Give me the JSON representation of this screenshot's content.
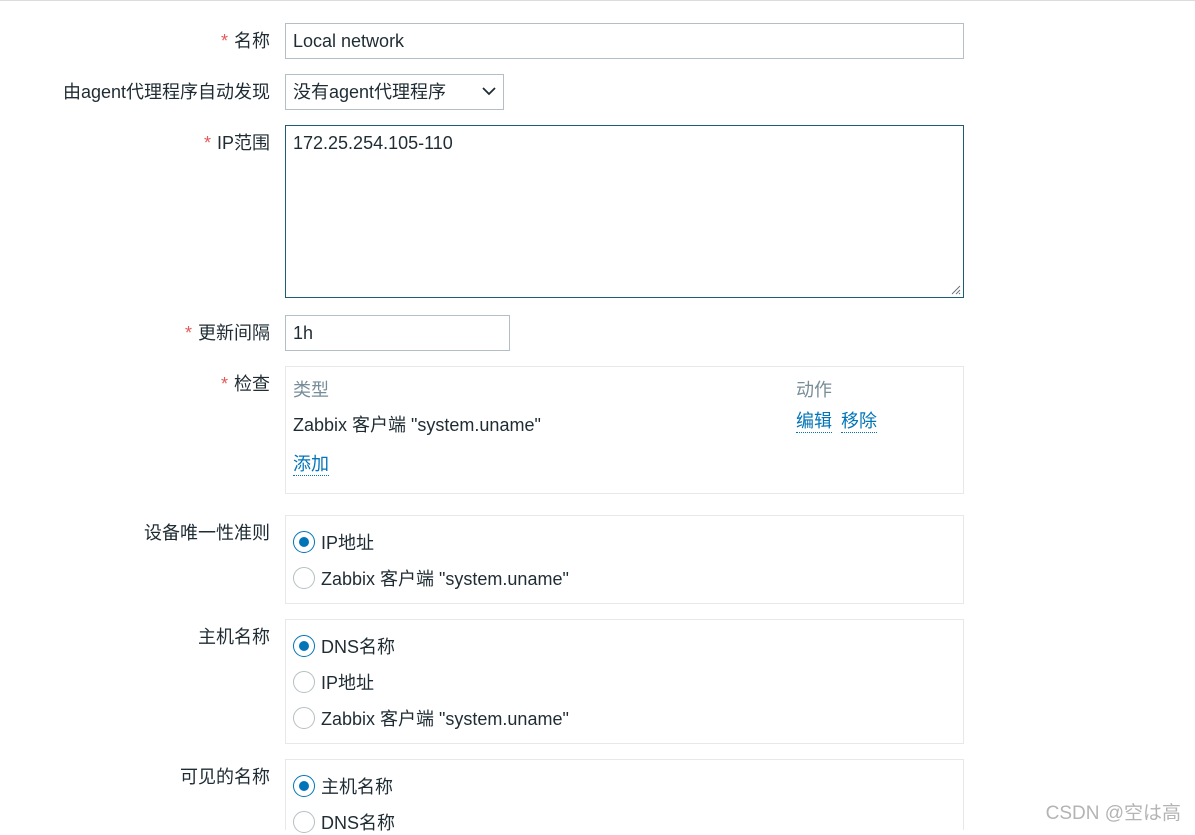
{
  "form": {
    "name": {
      "label": "名称",
      "value": "Local network"
    },
    "discovery_by_proxy": {
      "label": "由agent代理程序自动发现",
      "selected": "没有agent代理程序"
    },
    "ip_range": {
      "label": "IP范围",
      "value": "172.25.254.105-110"
    },
    "update_interval": {
      "label": "更新间隔",
      "value": "1h"
    },
    "checks": {
      "label": "检查",
      "columns": {
        "type": "类型",
        "action": "动作"
      },
      "rows": [
        {
          "type": "Zabbix 客户端 \"system.uname\"",
          "edit": "编辑",
          "remove": "移除"
        }
      ],
      "add_label": "添加"
    },
    "uniqueness": {
      "label": "设备唯一性准则",
      "options": [
        "IP地址",
        "Zabbix 客户端 \"system.uname\""
      ],
      "selected_index": 0
    },
    "host_name": {
      "label": "主机名称",
      "options": [
        "DNS名称",
        "IP地址",
        "Zabbix 客户端 \"system.uname\""
      ],
      "selected_index": 0
    },
    "visible_name": {
      "label": "可见的名称",
      "options": [
        "主机名称",
        "DNS名称"
      ],
      "selected_index": 0
    },
    "required_marker": "*"
  },
  "watermark": "CSDN @空は高",
  "colors": {
    "accent": "#0275b8",
    "required": "#e45959",
    "focus_border": "#1f5c73"
  },
  "icons": {
    "select": "chevron-down-icon",
    "resize": "resize-handle-icon"
  }
}
